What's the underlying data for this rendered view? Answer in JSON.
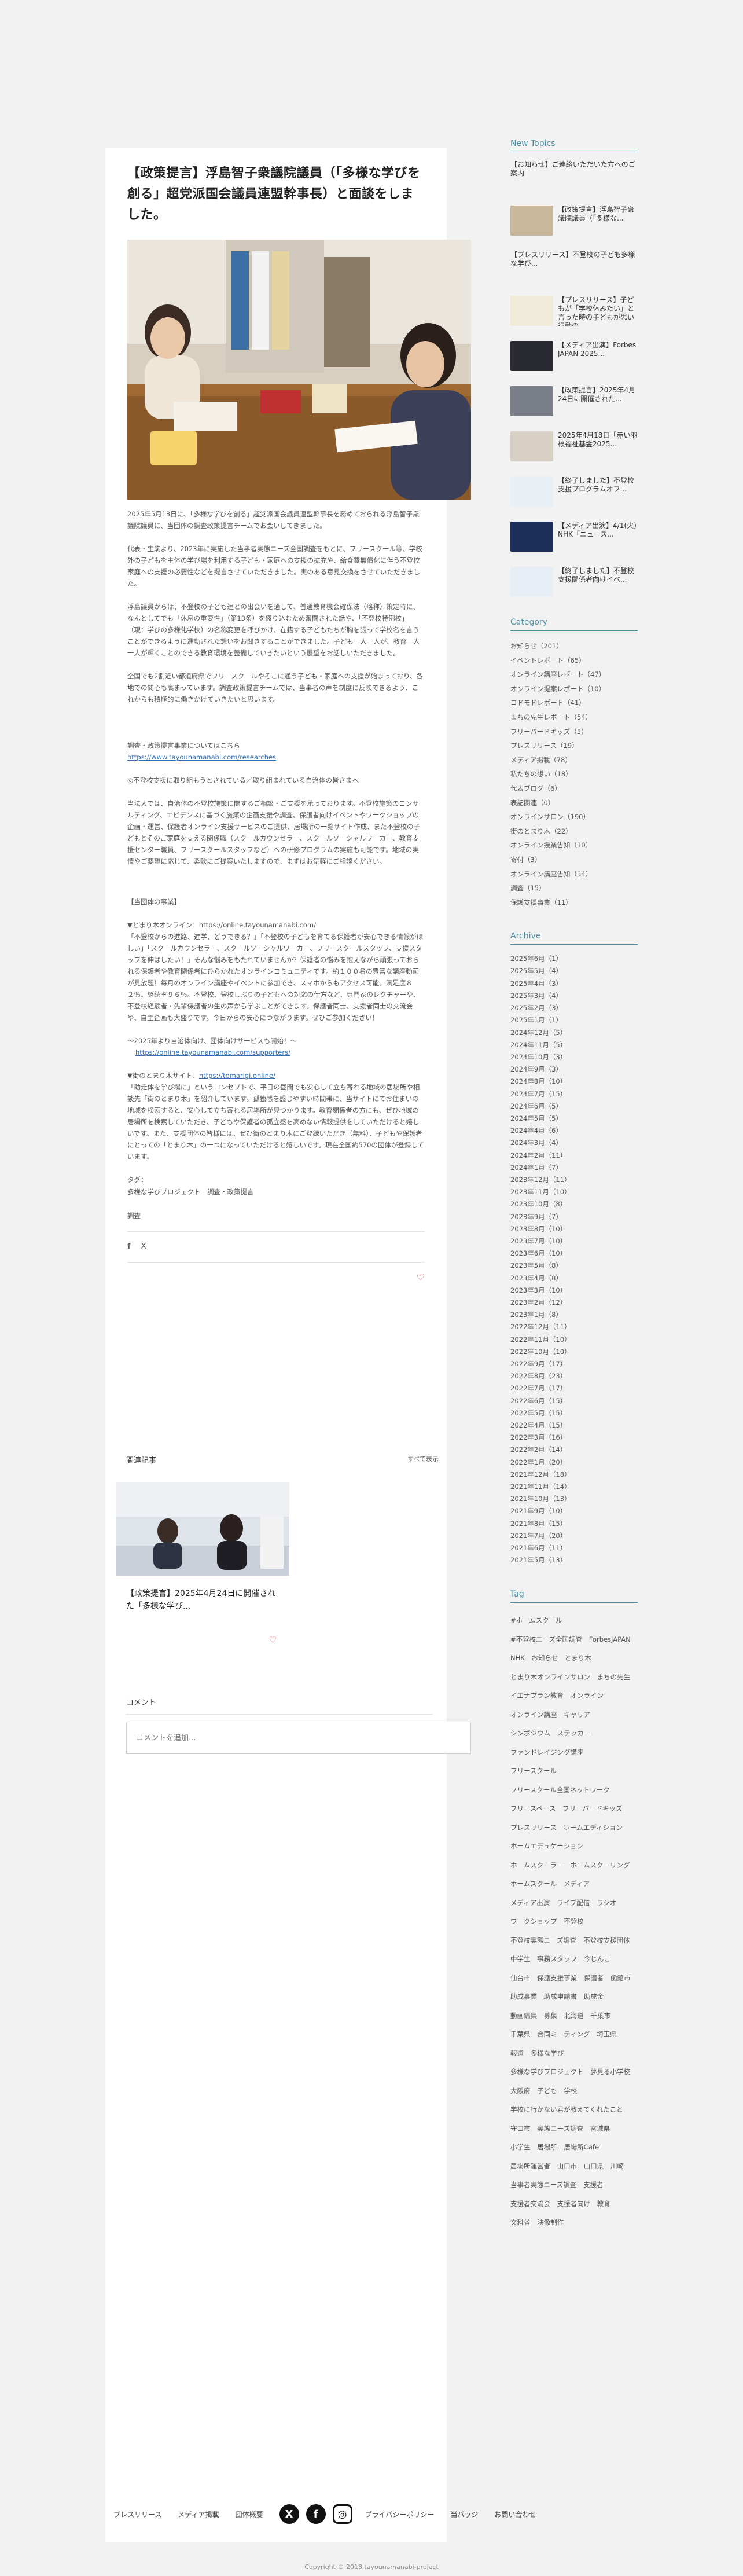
{
  "post": {
    "title": "【政策提言】浮島智子衆議院議員（「多様な学びを創る」超党派国会議員連盟幹事長）と面談をしました。",
    "paragraphs": [
      "2025年5月13日に、「多様な学びを創る」超党派国会議員連盟幹事長を務めておられる浮島智子衆議院議員に、当団体の調査政策提言チームでお会いしてきました。",
      "代表・生駒より、2023年に実施した当事者実態ニーズ全国調査をもとに、フリースクール等、学校外の子どもを主体の学び場を利用する子ども・家庭への支援の拡充や、給食費無償化に伴う不登校家庭への支援の必要性などを提言させていただきました。実のある意見交換をさせていただきました。",
      "浮島議員からは、不登校の子ども達との出会いを通して、普通教育機会確保法（略称）策定時に、なんとしてでも「休息の重要性」（第13条）を盛り込むため奮闘された話や、「不登校特例校」（現：学びの多様化学校）の名称変更を呼びかけ、在籍する子どもたちが胸を張って学校名を言うことができるように運動された想いをお聞きすることができました。子ども一人一人が、教育一人一人が輝くことのできる教育環境を整備していきたいという展望をお話しいただきました。",
      "全国でも2割近い都道府県でフリースクールやそこに通う子ども・家庭への支援が始まっており、各地での関心も高まっています。調査政策提言チームでは、当事者の声を制度に反映できるよう、これからも積極的に働きかけていきたいと思います。"
    ],
    "lead_research": "調査・政策提言事業についてはこちら",
    "research_url": "https://www.tayounamanabi.com/researches",
    "notice_heading": "◎不登校支援に取り組もうとされている／取り組まれている自治体の皆さまへ",
    "notice_body": "当法人では、自治体の不登校施策に関するご相談・ご支援を承っております。不登校施策のコンサルティング、エビデンスに基づく施策の企画支援や調査、保護者向けイベントやワークショップの企画・運営、保護者オンライン支援サービスのご提供、居場所の一覧サイト作成、また不登校の子どもとそのご家庭を支える関係職（スクールカウンセラー、スクールソーシャルワーカー、教育支援センター職員、フリースクールスタッフなど）への研修プログラムの実施も可能です。地域の実情やご要望に応じて、柔軟にご提案いたしますので、まずはお気軽にご相談ください。",
    "services_heading": "【当団体の事業】",
    "service1_title": "▼とまり木オンライン：https://online.tayounamanabi.com/",
    "service1_body": "「不登校からの進路、進学、どうできる？」「不登校の子どもを育てる保護者が安心できる情報がほしい」「スクールカウンセラー、スクールソーシャルワーカー、フリースクールスタッフ、支援スタッフを伸ばしたい！」そんな悩みをもたれていませんか？保護者の悩みを抱えながら頑張っておられる保護者や教育関係者にひらかれたオンラインコミュニティです。約１００名の豊富な講座動画が見放題！毎月のオンライン講座やイベントに参加でき、スマホからもアクセス可能。満足度８２％、継続率９６％。不登校、登校しぶりの子どもへの対応の仕方など、専門家のレクチャーや、不登校経験者・先輩保護者の生の声から学ぶことができます。保護者同士、支援者同士の交流会や、自主企画も大盛りです。今日からの安心につながります。ぜひご参加ください！",
    "service1_note": "〜2025年より自治体向け、団体向けサービスも開始！〜",
    "service1_url": "https://online.tayounamanabi.com/supporters/",
    "service2_title_prefix": "▼街のとまり木サイト：",
    "service2_url": "https://tomarigi.online/",
    "service2_body": "「助走体を学び場に」というコンセプトで、平日の昼間でも安心して立ち寄れる地域の居場所や相談先「街のとまり木」を紹介しています。孤独感を感じやすい時間帯に、当サイトにてお住まいの地域を検索すると、安心して立ち寄れる居場所が見つかります。教育関係者の方にも、ぜひ地域の居場所を検索していただき、子どもや保護者の孤立感を高めない情報提供をしていただけると嬉しいです。また、支援団体の皆様には、ぜひ街のとまり木にご登録いただき（無料）、子どもや保護者にとっての「とまり木」の一つになっていただけると嬉しいです。現在全国約570の団体が登録しています。",
    "tags_label": "タグ：",
    "tags_value": "多様な学びプロジェクト　調査・政策提言",
    "category_label": "調査"
  },
  "share": {
    "fb": "f",
    "x": "X"
  },
  "related": {
    "heading": "関連記事",
    "see_all": "すべて表示",
    "card_title": "【政策提言】2025年4月24日に開催された「多様な学び..."
  },
  "comments": {
    "heading": "コメント",
    "placeholder": "コメントを追加..."
  },
  "sidebar": {
    "news_heading": "New Topics",
    "news": [
      "【お知らせ】ご連絡いただいた方へのご案内",
      "【政策提言】浮島智子衆議院議員（「多様な...",
      "【プレスリリース】不登校の子ども多様な学び...",
      "【プレスリリース】子どもが「学校休みたい」と言った時の子どもが思い行動の...",
      "【メディア出演】Forbes JAPAN 2025...",
      "【政策提言】2025年4月24日に開催された...",
      "2025年4月18日「赤い羽根福祉基金2025...",
      "【終了しました】不登校支援プログラムオフ...",
      "【メディア出演】4/1(火) NHK「ニュース...",
      "【終了しました】不登校支援関係者向けイベ..."
    ],
    "category_heading": "Category",
    "categories": [
      "お知らせ（201）",
      "イベントレポート（65）",
      "オンライン講座レポート（47）",
      "オンライン提案レポート（10）",
      "コドモドレポート（41）",
      "まちの先生レポート（54）",
      "フリーバードキッズ（5）",
      "プレスリリース（19）",
      "メディア掲載（78）",
      "私たちの想い（18）",
      "代表ブログ（6）",
      "表記関連（0）",
      "オンラインサロン（190）",
      "街のとまり木（22）",
      "オンライン授業告知（10）",
      "寄付（3）",
      "オンライン講座告知（34）",
      "調査（15）",
      "保護支援事業（11）"
    ],
    "archive_heading": "Archive",
    "archive": [
      "2025年6月（1）",
      "2025年5月（4）",
      "2025年4月（3）",
      "2025年3月（4）",
      "2025年2月（3）",
      "2025年1月（1）",
      "2024年12月（5）",
      "2024年11月（5）",
      "2024年10月（3）",
      "2024年9月（3）",
      "2024年8月（10）",
      "2024年7月（15）",
      "2024年6月（5）",
      "2024年5月（5）",
      "2024年4月（6）",
      "2024年3月（4）",
      "2024年2月（11）",
      "2024年1月（7）",
      "2023年12月（11）",
      "2023年11月（10）",
      "2023年10月（8）",
      "2023年9月（7）",
      "2023年8月（10）",
      "2023年7月（10）",
      "2023年6月（10）",
      "2023年5月（8）",
      "2023年4月（8）",
      "2023年3月（10）",
      "2023年2月（12）",
      "2023年1月（8）",
      "2022年12月（11）",
      "2022年11月（10）",
      "2022年10月（10）",
      "2022年9月（17）",
      "2022年8月（23）",
      "2022年7月（17）",
      "2022年6月（15）",
      "2022年5月（15）",
      "2022年4月（15）",
      "2022年3月（16）",
      "2022年2月（14）",
      "2022年1月（20）",
      "2021年12月（18）",
      "2021年11月（14）",
      "2021年10月（13）",
      "2021年9月（10）",
      "2021年8月（15）",
      "2021年7月（20）",
      "2021年6月（11）",
      "2021年5月（13）"
    ],
    "tag_heading": "Tag",
    "tags": [
      "#ホームスクール",
      "#不登校ニーズ全国調査",
      "ForbesJAPAN",
      "NHK",
      "お知らせ",
      "とまり木",
      "とまり木オンラインサロン",
      "まちの先生",
      "イエナプラン教育",
      "オンライン",
      "オンライン講座",
      "キャリア",
      "シンポジウム",
      "ステッカー",
      "ファンドレイジング講座",
      "フリースクール",
      "フリースクール全国ネットワーク",
      "フリースペース",
      "フリーバードキッズ",
      "プレスリリース",
      "ホームエディション",
      "ホームエデュケーション",
      "ホームスクーラー",
      "ホームスクーリング",
      "ホームスクール",
      "メディア",
      "メディア出演",
      "ライブ配信",
      "ラジオ",
      "ワークショップ",
      "不登校",
      "不登校実態ニーズ調査",
      "不登校支援団体",
      "中学生",
      "事務スタッフ",
      "今じんこ",
      "仙台市",
      "保護支援事業",
      "保護者",
      "函館市",
      "助成事業",
      "助成申請書",
      "助成金",
      "動画編集",
      "募集",
      "北海道",
      "千葉市",
      "千葉県",
      "合同ミーティング",
      "埼玉県",
      "報道",
      "多様な学び",
      "多様な学びプロジェクト",
      "夢見る小学校",
      "大阪府",
      "子ども",
      "学校",
      "学校に行かない君が教えてくれたこと",
      "守口市",
      "実態ニーズ調査",
      "宮城県",
      "小学生",
      "居場所",
      "居場所Cafe",
      "居場所運営者",
      "山口市",
      "山口県",
      "川崎",
      "当事者実態ニーズ調査",
      "支援者",
      "支援者交流会",
      "支援者向け",
      "教育",
      "文科省",
      "映像制作"
    ]
  },
  "footer": {
    "links": [
      "プレスリリース",
      "メディア掲載",
      "団体概要"
    ],
    "x": "X",
    "fb": "f",
    "ig": "◎",
    "privacy": "プライバシーポリシー",
    "badge": "当バッジ",
    "contact": "お問い合わせ",
    "copyright": "Copyright © 2018 tayounamanabi-project"
  },
  "colors": {
    "accent": "#4a90a4",
    "heart": "#e05050",
    "link": "#2f6fb5"
  }
}
